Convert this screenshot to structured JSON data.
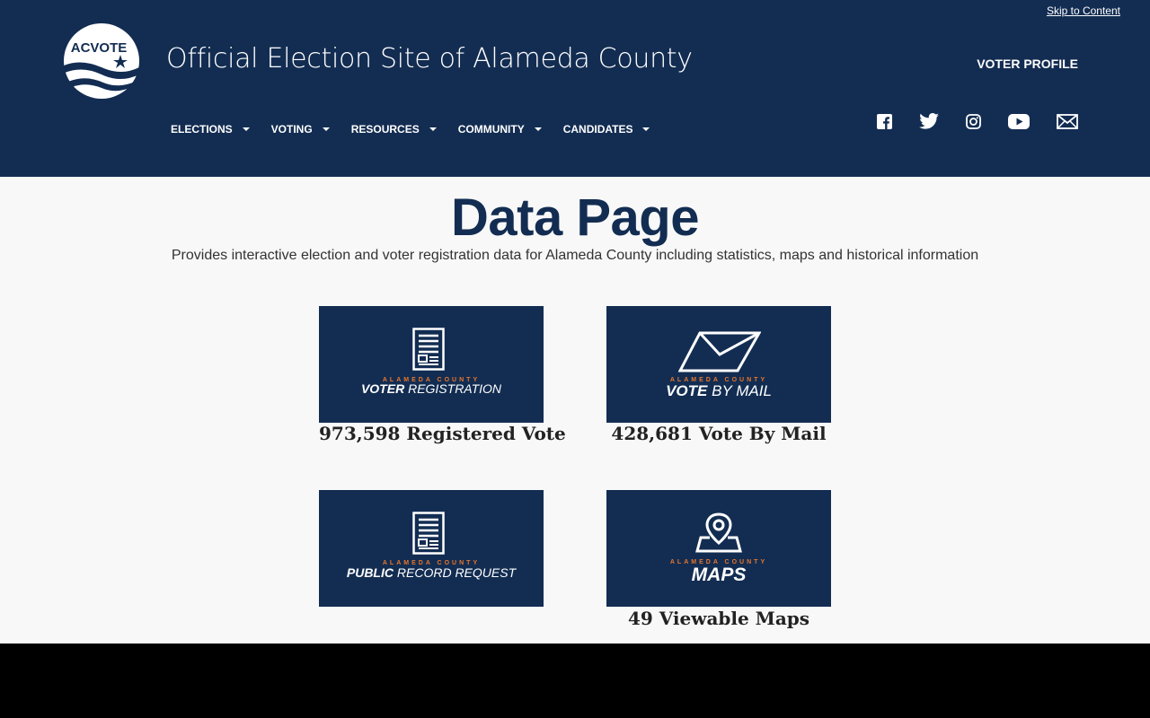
{
  "header": {
    "skip_link": "Skip to Content",
    "logo_text": "ACVOTE",
    "site_title": "Official Election Site of Alameda County",
    "voter_profile": "VOTER PROFILE",
    "nav": [
      {
        "label": "ELECTIONS"
      },
      {
        "label": "VOTING"
      },
      {
        "label": "RESOURCES"
      },
      {
        "label": "COMMUNITY"
      },
      {
        "label": "CANDIDATES"
      }
    ],
    "social_icons": [
      "facebook-icon",
      "twitter-icon",
      "instagram-icon",
      "youtube-icon",
      "email-icon"
    ]
  },
  "main": {
    "title": "Data Page",
    "description": "Provides interactive election and voter registration data for Alameda County including statistics, maps and historical information",
    "cards": [
      {
        "county": "ALAMEDA COUNTY",
        "title_bold": "VOTER",
        "title_light": "REGISTRATION",
        "label": "973,598 Registered Vote",
        "icon": "document-icon"
      },
      {
        "county": "ALAMEDA COUNTY",
        "title_bold": "VOTE",
        "title_light": "BY MAIL",
        "label": "428,681 Vote By Mail",
        "icon": "envelope-icon"
      },
      {
        "county": "ALAMEDA COUNTY",
        "title_bold": "PUBLIC",
        "title_light": "RECORD REQUEST",
        "label": "",
        "icon": "document-icon"
      },
      {
        "county": "ALAMEDA COUNTY",
        "title_bold": "MAPS",
        "title_light": "",
        "label": "49 Viewable Maps",
        "icon": "map-pin-icon"
      }
    ]
  },
  "colors": {
    "navy": "#132d52",
    "accent": "#e8762b",
    "background": "#f8f8f8"
  }
}
